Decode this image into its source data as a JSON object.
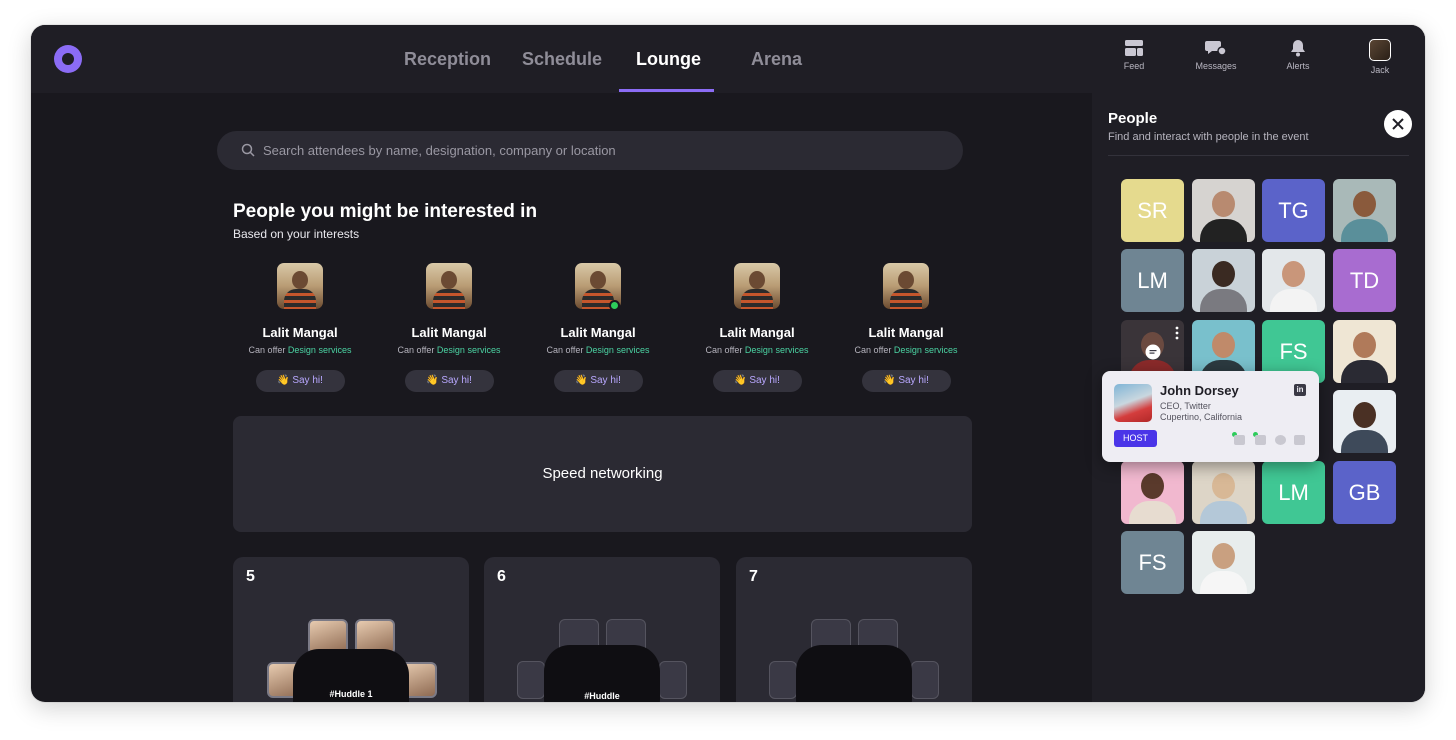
{
  "nav": {
    "tabs": [
      "Reception",
      "Schedule",
      "Lounge",
      "Arena"
    ],
    "active_tab": "Lounge",
    "icons": [
      {
        "label": "Feed",
        "icon": "feed-icon"
      },
      {
        "label": "Messages",
        "icon": "messages-icon"
      },
      {
        "label": "Alerts",
        "icon": "bell-icon"
      },
      {
        "label": "Jack",
        "icon": "user-avatar"
      }
    ]
  },
  "search": {
    "placeholder": "Search attendees by name, designation, company or location"
  },
  "recommend": {
    "title": "People you might be interested in",
    "subtitle": "Based on your interests",
    "people": [
      {
        "name": "Lalit Mangal",
        "offer_prefix": "Can offer",
        "offer": "Design services",
        "action": "👋 Say hi!"
      },
      {
        "name": "Lalit Mangal",
        "offer_prefix": "Can offer",
        "offer": "Design services",
        "action": "👋 Say hi!"
      },
      {
        "name": "Lalit Mangal",
        "offer_prefix": "Can offer",
        "offer": "Design services",
        "action": "👋 Say hi!"
      },
      {
        "name": "Lalit Mangal",
        "offer_prefix": "Can offer",
        "offer": "Design services",
        "action": "👋 Say hi!"
      },
      {
        "name": "Lalit Mangal",
        "offer_prefix": "Can offer",
        "offer": "Design services",
        "action": "👋 Say hi!"
      }
    ]
  },
  "speed_networking": {
    "label": "Speed networking"
  },
  "tables": [
    {
      "number": "5",
      "label": "#Huddle 1"
    },
    {
      "number": "6",
      "label": "#Huddle"
    },
    {
      "number": "7",
      "label": ""
    }
  ],
  "people_panel": {
    "title": "People",
    "subtitle": "Find and interact with people in the event",
    "tiles": [
      {
        "initials": "SR",
        "color": "#e5da8e"
      },
      {
        "initials": "",
        "color": "#d6d3d0"
      },
      {
        "initials": "TG",
        "color": "#5b63c9"
      },
      {
        "initials": "",
        "color": "#a9b9b8"
      },
      {
        "initials": "LM",
        "color": "#6f8593"
      },
      {
        "initials": "",
        "color": "#c9d2d8"
      },
      {
        "initials": "",
        "color": "#e3e7ea"
      },
      {
        "initials": "TD",
        "color": "#a86cd0"
      },
      {
        "initials": "",
        "color": "#3a3439"
      },
      {
        "initials": "",
        "color": "#79c0cc"
      },
      {
        "initials": "FS",
        "color": "#40c794"
      },
      {
        "initials": "",
        "color": "#efe6d4"
      },
      {
        "initials": "",
        "color": "#e9eef2"
      },
      {
        "initials": "",
        "color": "#f1b8cf"
      },
      {
        "initials": "",
        "color": "#ddd5c7"
      },
      {
        "initials": "LM",
        "color": "#40c794"
      },
      {
        "initials": "GB",
        "color": "#5b63c9"
      },
      {
        "initials": "FS",
        "color": "#6f8593"
      },
      {
        "initials": "",
        "color": "#e8eded"
      }
    ]
  },
  "popover": {
    "name": "John Dorsey",
    "role": "CEO, Twitter",
    "location": "Cupertino, California",
    "badge": "HOST",
    "linkedin": "in"
  }
}
